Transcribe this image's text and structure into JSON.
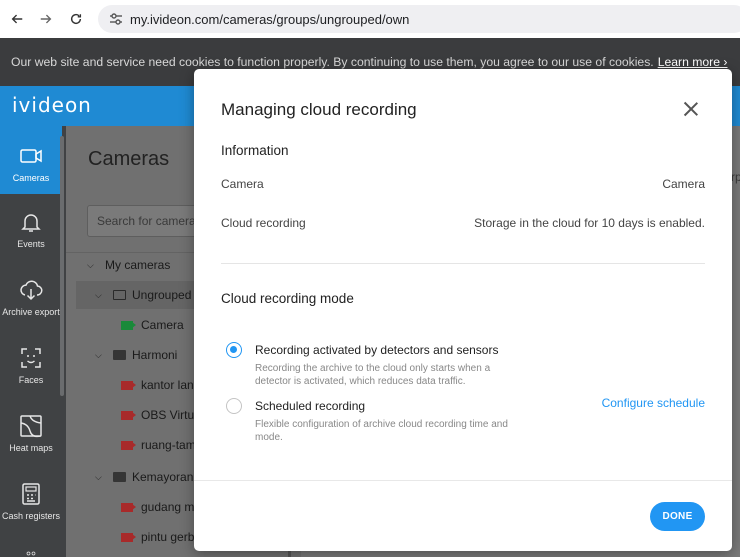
{
  "browser": {
    "url": "my.ivideon.com/cameras/groups/ungrouped/own",
    "back_icon": "arrow-left-icon",
    "forward_icon": "arrow-right-icon",
    "reload_icon": "reload-icon",
    "site_settings_icon": "tune-icon"
  },
  "cookie_banner": {
    "text": "Our web site and service need cookies to function properly. By continuing to use them, you agree to our use of cookies.",
    "link": "Learn more ›"
  },
  "app": {
    "logo": "ivideon",
    "brand_color": "#1f8ad3"
  },
  "rail": {
    "items": [
      {
        "label": "Cameras",
        "icon": "camera-icon"
      },
      {
        "label": "Events",
        "icon": "bell-icon"
      },
      {
        "label": "Archive export",
        "icon": "cloud-download-icon"
      },
      {
        "label": "Faces",
        "icon": "face-scan-icon"
      },
      {
        "label": "Heat maps",
        "icon": "heat-map-icon"
      },
      {
        "label": "Cash registers",
        "icon": "cash-register-icon"
      }
    ]
  },
  "cameras_panel": {
    "title": "Cameras",
    "search_placeholder": "Search for cameras",
    "tree": [
      {
        "label": "My cameras"
      },
      {
        "label": "Ungrouped"
      },
      {
        "label": "Camera"
      },
      {
        "label": "Harmoni"
      },
      {
        "label": "kantor lant"
      },
      {
        "label": "OBS Virtua"
      },
      {
        "label": "ruang-tamu"
      },
      {
        "label": "Kemayoran"
      },
      {
        "label": "gudang ma"
      },
      {
        "label": "pintu gerba"
      }
    ]
  },
  "background": {
    "right_mark": "rp"
  },
  "modal": {
    "title": "Managing cloud recording",
    "info_heading": "Information",
    "camera_label": "Camera",
    "camera_value": "Camera",
    "cloud_label": "Cloud recording",
    "cloud_value": "Storage in the cloud for 10 days is enabled.",
    "mode_heading": "Cloud recording mode",
    "options": [
      {
        "title": "Recording activated by detectors and sensors",
        "desc": "Recording the archive to the cloud only starts when a detector is activated, which reduces data traffic."
      },
      {
        "title": "Scheduled recording",
        "desc": "Flexible configuration of archive cloud recording time and mode.",
        "link": "Configure schedule"
      }
    ],
    "done_label": "DONE",
    "accent_color": "#2196f3"
  }
}
